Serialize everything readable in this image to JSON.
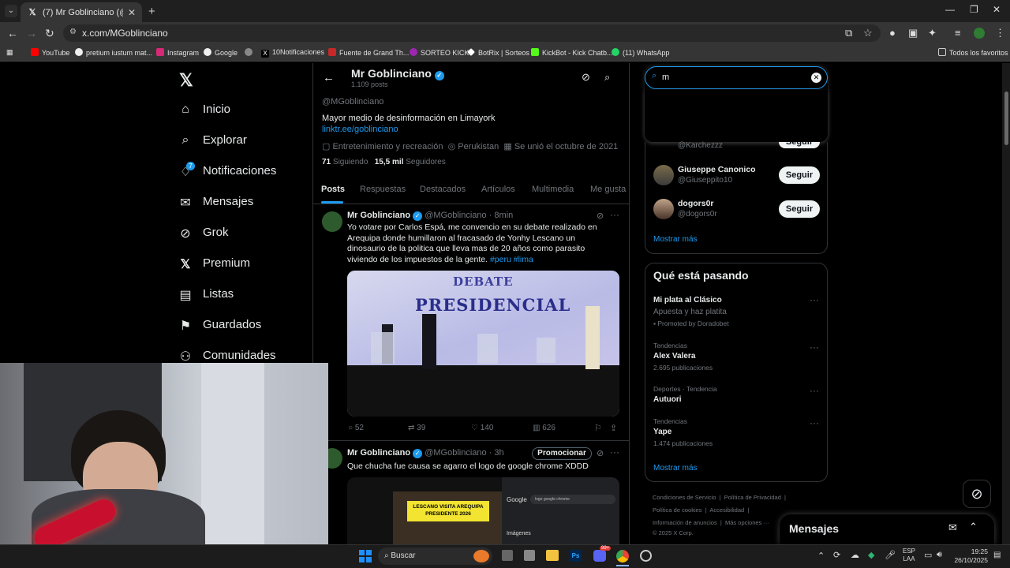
{
  "browser": {
    "tab_title": "(7) Mr Goblinciano (@MGoblinc",
    "url": "x.com/MGoblinciano",
    "bookmarks": [
      "YouTube",
      "pretium iustum mat...",
      "Instagram",
      "Google",
      "10Notificaciones",
      "Fuente de Grand Th...",
      "SORTEO KICK",
      "BotRix | Sorteos",
      "KickBot - Kick Chatb...",
      "(11) WhatsApp"
    ],
    "all_bookmarks": "Todos los favoritos"
  },
  "nav": {
    "items": [
      "Inicio",
      "Explorar",
      "Notificaciones",
      "Mensajes",
      "Grok",
      "Premium",
      "Listas",
      "Guardados",
      "Comunidades"
    ],
    "notif_badge": "7"
  },
  "profile": {
    "name": "Mr Goblinciano",
    "posts_count": "1.109 posts",
    "handle": "@MGoblinciano",
    "bio": "Mayor medio de desinformación en Limayork",
    "link": "linktr.ee/goblinciano",
    "category": "Entretenimiento y recreación",
    "location": "Perukistan",
    "joined": "Se unió el octubre de 2021",
    "following_count": "71",
    "following_label": "Siguiendo",
    "followers_count": "15,5 mil",
    "followers_label": "Seguidores",
    "tabs": [
      "Posts",
      "Respuestas",
      "Destacados",
      "Artículos",
      "Multimedia",
      "Me gusta"
    ]
  },
  "posts": [
    {
      "name": "Mr Goblinciano",
      "handle": "@MGoblinciano",
      "time": "8min",
      "text": "Yo votare por Carlos Espá, me convencio en su debate realizado en Arequipa donde humillaron al fracasado de Yonhy Lescano un dinosaurio de la politica que lleva mas de 20 años como parasito viviendo de los impuestos de la gente.",
      "hashtags": "#peru #lima",
      "image_title_1": "DEBATE",
      "image_title_2": "PRESIDENCIAL",
      "replies": "52",
      "reposts": "39",
      "likes": "140",
      "views": "626"
    },
    {
      "name": "Mr Goblinciano",
      "handle": "@MGoblinciano",
      "time": "3h",
      "promote": "Promocionar",
      "text": "Que chucha fue causa se agarro el logo de google chrome XDDD",
      "img_caption_1": "LESCANO VISITA AREQUIPA",
      "img_caption_2": "PRESIDENTE 2026",
      "img_google": "Google",
      "img_search": "logo google chrome",
      "img_images": "Imágenes"
    }
  ],
  "search": {
    "value": "m"
  },
  "who_to_follow": {
    "partial_handle": "@Karchezzz",
    "users": [
      {
        "name": "Giuseppe Canonico",
        "handle": "@Giuseppito10",
        "button": "Seguir"
      },
      {
        "name": "dogors0r",
        "handle": "@dogors0r",
        "button": "Seguir"
      }
    ],
    "partial_button": "Seguir",
    "show_more": "Mostrar más"
  },
  "trends": {
    "title": "Qué está pasando",
    "items": [
      {
        "context": "",
        "name": "Mi plata al Clásico",
        "sub": "Apuesta y haz platita",
        "promoted": "Promoted by Doradobet"
      },
      {
        "context": "Tendencias",
        "name": "Alex Valera",
        "sub": "2.695 publicaciones"
      },
      {
        "context": "Deportes · Tendencia",
        "name": "Autuori",
        "sub": ""
      },
      {
        "context": "Tendencias",
        "name": "Yape",
        "sub": "1.474 publicaciones"
      }
    ],
    "show_more": "Mostrar más"
  },
  "footer": {
    "links": [
      "Condiciones de Servicio",
      "Política de Privacidad",
      "Política de cookies",
      "Accesibilidad",
      "Información de anuncios",
      "Más opciones ···"
    ],
    "copyright": "© 2025 X Corp."
  },
  "messages_bar": {
    "title": "Mensajes"
  },
  "taskbar": {
    "search": "Buscar",
    "lang1": "ESP",
    "lang2": "LAA",
    "time": "19:25",
    "date": "26/10/2025",
    "discord_badge": "99+"
  }
}
